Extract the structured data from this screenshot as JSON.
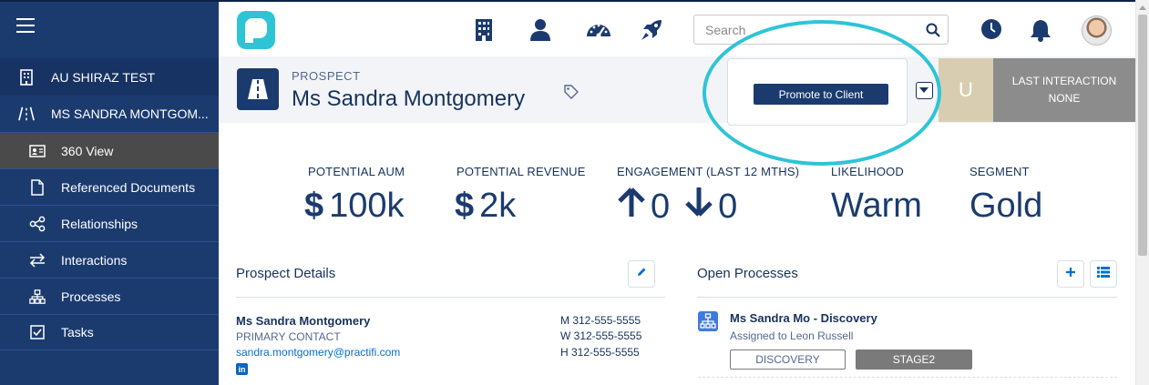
{
  "sidebar": {
    "items": [
      {
        "label": "AU SHIRAZ TEST",
        "icon": "building-icon"
      },
      {
        "label": "MS SANDRA MONTGOM...",
        "icon": "road-icon"
      },
      {
        "label": "360 View",
        "icon": "contact-card-icon"
      },
      {
        "label": "Referenced Documents",
        "icon": "document-icon"
      },
      {
        "label": "Relationships",
        "icon": "share-icon"
      },
      {
        "label": "Interactions",
        "icon": "exchange-icon"
      },
      {
        "label": "Processes",
        "icon": "hierarchy-icon"
      },
      {
        "label": "Tasks",
        "icon": "checkbox-icon"
      }
    ]
  },
  "topbar": {
    "icons": [
      "building-icon",
      "person-icon",
      "dashboard-icon",
      "rocket-icon",
      "clock-icon",
      "bell-icon"
    ],
    "search_placeholder": "Search"
  },
  "record": {
    "type": "PROSPECT",
    "name": "Ms Sandra Montgomery",
    "promote_label": "Promote to Client",
    "user_initial": "U",
    "last_interaction_label": "LAST INTERACTION",
    "last_interaction_value": "NONE"
  },
  "metrics": {
    "aum_label": "POTENTIAL AUM",
    "aum_currency": "$",
    "aum_value": "100k",
    "revenue_label": "POTENTIAL REVENUE",
    "revenue_currency": "$",
    "revenue_value": "2k",
    "engagement_label": "ENGAGEMENT (LAST 12 MTHS)",
    "engagement_up": "0",
    "engagement_down": "0",
    "likelihood_label": "LIKELIHOOD",
    "likelihood_value": "Warm",
    "segment_label": "SEGMENT",
    "segment_value": "Gold"
  },
  "prospect_details": {
    "title": "Prospect Details",
    "name": "Ms Sandra Montgomery",
    "role": "PRIMARY CONTACT",
    "email": "sandra.montgomery@practifi.com",
    "linkedin": "in",
    "phone_mobile": "M 312-555-5555",
    "phone_work": "W 312-555-5555",
    "phone_home": "H 312-555-5555"
  },
  "open_processes": {
    "title": "Open Processes",
    "items": [
      {
        "title": "Ms Sandra Mo - Discovery",
        "assigned": "Assigned to Leon Russell",
        "stage_1": "DISCOVERY",
        "stage_2": "STAGE2"
      }
    ]
  },
  "colors": {
    "sidebar": "#1b3b6f",
    "accent": "#2ec4d6",
    "primary_text": "#16325c",
    "link": "#0070d2"
  }
}
